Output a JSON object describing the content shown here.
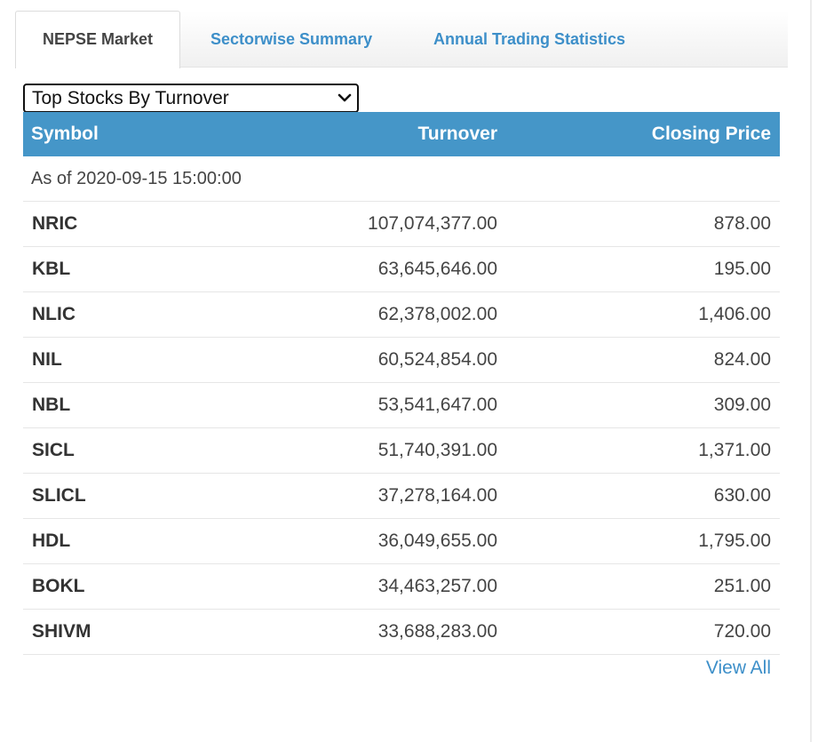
{
  "tabs": [
    {
      "label": "NEPSE Market",
      "active": true
    },
    {
      "label": "Sectorwise Summary",
      "active": false
    },
    {
      "label": "Annual Trading Statistics",
      "active": false
    }
  ],
  "select": {
    "value": "Top Stocks By Turnover",
    "icon": "chevron-down-icon"
  },
  "table": {
    "headers": {
      "symbol": "Symbol",
      "turnover": "Turnover",
      "closing_price": "Closing Price"
    },
    "as_of": "As of 2020-09-15 15:00:00",
    "rows": [
      {
        "symbol": "NRIC",
        "turnover": "107,074,377.00",
        "closing_price": "878.00"
      },
      {
        "symbol": "KBL",
        "turnover": "63,645,646.00",
        "closing_price": "195.00"
      },
      {
        "symbol": "NLIC",
        "turnover": "62,378,002.00",
        "closing_price": "1,406.00"
      },
      {
        "symbol": "NIL",
        "turnover": "60,524,854.00",
        "closing_price": "824.00"
      },
      {
        "symbol": "NBL",
        "turnover": "53,541,647.00",
        "closing_price": "309.00"
      },
      {
        "symbol": "SICL",
        "turnover": "51,740,391.00",
        "closing_price": "1,371.00"
      },
      {
        "symbol": "SLICL",
        "turnover": "37,278,164.00",
        "closing_price": "630.00"
      },
      {
        "symbol": "HDL",
        "turnover": "36,049,655.00",
        "closing_price": "1,795.00"
      },
      {
        "symbol": "BOKL",
        "turnover": "34,463,257.00",
        "closing_price": "251.00"
      },
      {
        "symbol": "SHIVM",
        "turnover": "33,688,283.00",
        "closing_price": "720.00"
      }
    ]
  },
  "view_all_label": "View All",
  "colors": {
    "header_bg": "#4596c8",
    "link": "#3d8fc9"
  }
}
